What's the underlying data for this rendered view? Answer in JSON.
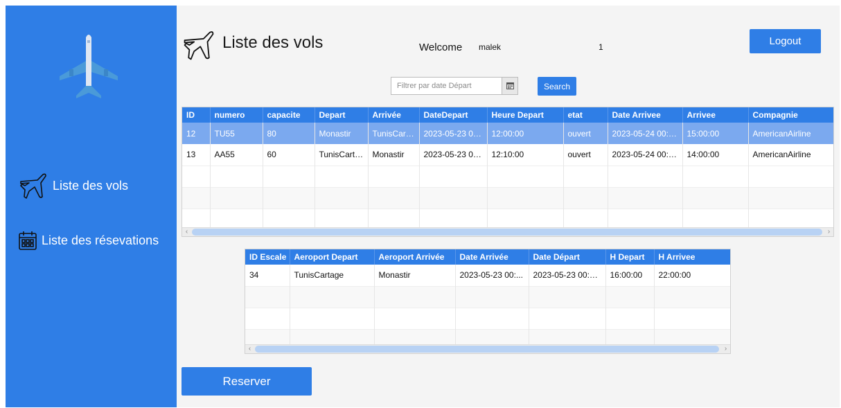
{
  "sidebar": {
    "nav": [
      {
        "label": "Liste des vols"
      },
      {
        "label": "Liste des résevations"
      }
    ]
  },
  "header": {
    "title": "Liste des vols",
    "welcome_label": "Welcome",
    "username": "malek",
    "user_id": "1",
    "logout_label": "Logout"
  },
  "filter": {
    "date_placeholder": "Filtrer par date Départ",
    "search_label": "Search"
  },
  "vols_table": {
    "columns": [
      "ID",
      "numero",
      "capacite",
      "Depart",
      "Arrivée",
      "DateDepart",
      "Heure Depart",
      "etat",
      "Date Arrivee",
      "Arrivee",
      "Compagnie"
    ],
    "rows": [
      [
        "12",
        "TU55",
        "80",
        "Monastir",
        "TunisCart...",
        "2023-05-23 00...",
        "12:00:00",
        "ouvert",
        "2023-05-24 00:0...",
        "15:00:00",
        "AmericanAirline"
      ],
      [
        "13",
        "AA55",
        "60",
        "TunisCarta...",
        "Monastir",
        "2023-05-23 00...",
        "12:10:00",
        "ouvert",
        "2023-05-24 00:0...",
        "14:00:00",
        "AmericanAirline"
      ]
    ],
    "selected_row": 0
  },
  "escale_table": {
    "columns": [
      "ID Escale",
      "Aeroport Depart",
      "Aeroport Arrivée",
      "Date Arrivée",
      "Date Départ",
      "H Depart",
      "H Arrivee"
    ],
    "rows": [
      [
        "34",
        "TunisCartage",
        "Monastir",
        "2023-05-23 00:...",
        "2023-05-23 00:0...",
        "16:00:00",
        "22:00:00"
      ]
    ]
  },
  "actions": {
    "reserver_label": "Reserver"
  },
  "colors": {
    "accent": "#2f7ee6",
    "selected_row": "#7ba9ef",
    "background": "#f4f4f4"
  },
  "icons": [
    "plane-logo-icon",
    "plane-outline-icon",
    "calendar-icon"
  ]
}
